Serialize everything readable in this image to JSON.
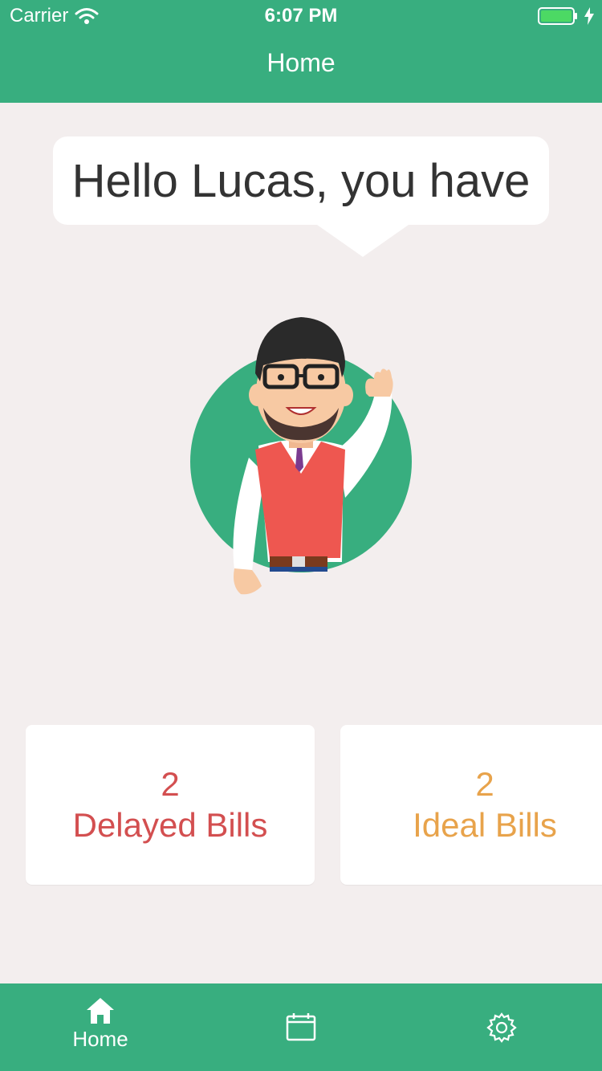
{
  "status_bar": {
    "carrier": "Carrier",
    "time": "6:07 PM"
  },
  "nav": {
    "title": "Home"
  },
  "greeting": {
    "text": "Hello Lucas, you have"
  },
  "cards": [
    {
      "count": "2",
      "label": "Delayed Bills",
      "color": "#d34f50"
    },
    {
      "count": "2",
      "label": "Ideal Bills",
      "color": "#e8a34b"
    }
  ],
  "tab_bar": {
    "items": [
      {
        "label": "Home",
        "icon": "home-icon",
        "active": true
      },
      {
        "label": "",
        "icon": "calendar-icon"
      },
      {
        "label": "",
        "icon": "gear-icon"
      }
    ]
  },
  "colors": {
    "primary": "#38ae7f",
    "background": "#f3eeee"
  }
}
